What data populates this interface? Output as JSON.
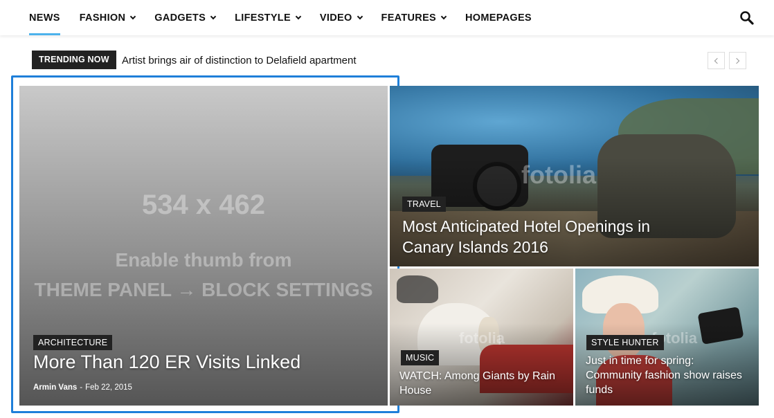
{
  "nav": {
    "items": [
      {
        "label": "NEWS",
        "dropdown": false,
        "active": true
      },
      {
        "label": "FASHION",
        "dropdown": true
      },
      {
        "label": "GADGETS",
        "dropdown": true
      },
      {
        "label": "LIFESTYLE",
        "dropdown": true
      },
      {
        "label": "VIDEO",
        "dropdown": true
      },
      {
        "label": "FEATURES",
        "dropdown": true
      },
      {
        "label": "HOMEPAGES",
        "dropdown": false
      }
    ],
    "search_icon": "search-icon",
    "accent_color": "#4db2ec"
  },
  "trending": {
    "label": "TRENDING NOW",
    "title": "Artist brings air of distinction to Delafield apartment",
    "prev_icon": "chevron-left-icon",
    "next_icon": "chevron-right-icon"
  },
  "featured": {
    "main": {
      "placeholder_size": "534 x 462",
      "placeholder_line1": "Enable thumb from",
      "placeholder_line2": "THEME PANEL → BLOCK SETTINGS",
      "category": "ARCHITECTURE",
      "title": "More Than 120 ER Visits Linked",
      "author": "Armin Vans",
      "separator": "-",
      "date": "Feb 22, 2015"
    },
    "travel": {
      "category": "TRAVEL",
      "title": "Most Anticipated Hotel Openings in Canary Islands 2016",
      "watermark": "fotolia"
    },
    "music": {
      "category": "MUSIC",
      "title": "WATCH: Among Giants by Rain House",
      "watermark": "fotolia"
    },
    "style": {
      "category": "STYLE HUNTER",
      "title": "Just in time for spring: Community fashion show raises funds",
      "watermark": "fotolia"
    }
  },
  "selection_color": "#1e7fd9"
}
